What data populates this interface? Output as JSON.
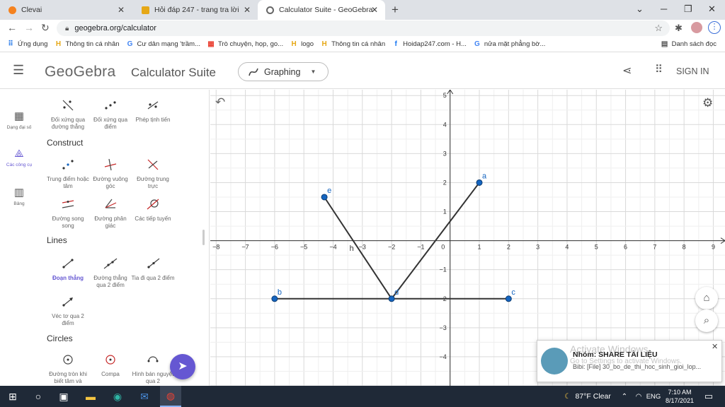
{
  "browser": {
    "tabs": [
      {
        "title": "Clevai",
        "active": false
      },
      {
        "title": "Hỏi đáp 247 - trang tra lời",
        "active": false
      },
      {
        "title": "Calculator Suite - GeoGebra",
        "active": true
      }
    ],
    "url": "geogebra.org/calculator",
    "bookmarks": [
      "Ứng dụng",
      "Thông tin cá nhân",
      "Cư dân mạng 'trầm...",
      "Trò chuyện, họp, go...",
      "logo",
      "Thông tin cá nhân",
      "Hoidap247.com - H...",
      "nửa mặt phẳng bờ..."
    ],
    "reading_list": "Danh sách đọc"
  },
  "app": {
    "logo": "GeoGebra",
    "suite": "Calculator Suite",
    "app_selector": "Graphing",
    "sign_in": "SIGN IN"
  },
  "rail": [
    {
      "label": "Dạng đại số",
      "icon": "calculator-icon",
      "active": false
    },
    {
      "label": "Các công cụ",
      "icon": "tools-icon",
      "active": true
    },
    {
      "label": "Bảng",
      "icon": "table-icon",
      "active": false
    }
  ],
  "tools": {
    "top_row": [
      "Đối xứng qua đường thẳng",
      "Đối xứng qua điểm",
      "Phép tịnh tiến"
    ],
    "sections": [
      {
        "title": "Construct",
        "items": [
          "Trung điểm hoặc tâm",
          "Đường vuông góc",
          "Đường trung trực",
          "Đường song song",
          "Đường phân giác",
          "Các tiếp tuyến"
        ]
      },
      {
        "title": "Lines",
        "items": [
          "Đoạn thẳng",
          "Đường thẳng qua 2 điểm",
          "Tia đi qua 2 điểm",
          "Véc tơ qua 2 điểm"
        ],
        "selected": "Đoạn thẳng"
      },
      {
        "title": "Circles",
        "items": [
          "Đường tròn khi biết tâm và",
          "Compa",
          "Hình bán nguyệt qua 2"
        ]
      }
    ]
  },
  "graph": {
    "x_ticks": [
      "−8",
      "−7",
      "−6",
      "−5",
      "−4",
      "−3",
      "−2",
      "−1",
      "0",
      "1",
      "2",
      "3",
      "4",
      "5",
      "6",
      "7",
      "8",
      "9"
    ],
    "y_ticks": [
      "5",
      "4",
      "3",
      "2",
      "1",
      "−1",
      "−2",
      "−3",
      "−4"
    ],
    "x_range": [
      -8.2,
      9.4
    ],
    "y_range": [
      -5.0,
      5.2
    ],
    "points": [
      {
        "label": "a",
        "x": 1,
        "y": 2
      },
      {
        "label": "b",
        "x": -6,
        "y": -2
      },
      {
        "label": "c",
        "x": 2,
        "y": -2
      },
      {
        "label": "d",
        "x": -2,
        "y": -2
      },
      {
        "label": "e",
        "x": -4.3,
        "y": 1.5
      }
    ],
    "segments": [
      [
        "b",
        "c"
      ],
      [
        "d",
        "a"
      ],
      [
        "d",
        "e"
      ]
    ],
    "segment_label": "h",
    "point_color": "#1565c0",
    "segment_color": "#333333"
  },
  "notification": {
    "title": "Nhóm: SHARE TÀI LIỆU",
    "body": "Bibi: [File] 30_bo_de_thi_hoc_sinh_gioi_lop...",
    "watermark1": "Activate Windows",
    "watermark2": "Go to Settings to activate Windows."
  },
  "taskbar": {
    "weather": "87°F  Clear",
    "lang": "ENG",
    "time": "7:10 AM",
    "date": "8/17/2021"
  }
}
